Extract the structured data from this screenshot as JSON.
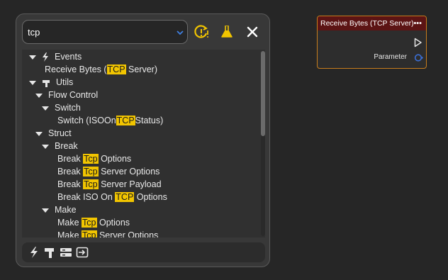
{
  "search": {
    "value": "tcp"
  },
  "tree": {
    "events_label": "Events",
    "receive_pre": "Receive Bytes (",
    "receive_hl": "TCP",
    "receive_post": " Server)",
    "utils_label": "Utils",
    "flow_control_label": "Flow Control",
    "switch_label": "Switch",
    "switch_item_pre": "Switch (ISOOn",
    "switch_item_hl": "TCP",
    "switch_item_post": "Status)",
    "struct_label": "Struct",
    "break_label": "Break",
    "break1_pre": "Break ",
    "break1_hl": "Tcp",
    "break1_post": " Options",
    "break2_pre": "Break ",
    "break2_hl": "Tcp",
    "break2_post": " Server Options",
    "break3_pre": "Break ",
    "break3_hl": "Tcp",
    "break3_post": " Server Payload",
    "break4_pre": "Break ISO On ",
    "break4_hl": "TCP",
    "break4_post": " Options",
    "make_label": "Make",
    "make1_pre": "Make ",
    "make1_hl": "Tcp",
    "make1_post": " Options",
    "make2_pre": "Make ",
    "make2_hl": "Tcp",
    "make2_post": " Server Options"
  },
  "node": {
    "title": "Receive Bytes (TCP Server)",
    "menu": "•••",
    "param_label": "Parameter"
  },
  "colors": {
    "accent_yellow": "#f2c500",
    "node_header": "#5c1414",
    "node_border": "#c77d1c",
    "param_pin": "#3b6fd8"
  },
  "icons": {
    "events": "lightning-icon",
    "utils": "hammer-icon",
    "toolbar": [
      "refresh-warning-icon",
      "flask-icon",
      "close-icon"
    ],
    "bottom": [
      "lightning-icon",
      "hammer-icon",
      "struct-icon",
      "convert-icon"
    ]
  }
}
